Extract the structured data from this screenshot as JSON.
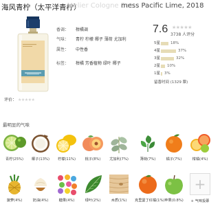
{
  "header": {
    "title_cn": "海风青柠（太平洋青柠）",
    "title_ghost": "Atelier Cologne Bot",
    "title_en": "mess Pacific Lime, 2018"
  },
  "info": {
    "family_label": "香调：",
    "family_value": "柑橘调",
    "smell_label": "气味：",
    "smell_value": "青柠 柠檬 椰子 薄荷 尤加利",
    "gender_label": "属性：",
    "gender_value": "中性香",
    "tags_label": "标签：",
    "tags_value": "柑橘 芳香植物 绿叶 椰子"
  },
  "score": {
    "value": "7.6",
    "stars": "★★★★★",
    "votes": "3738 人评分"
  },
  "distribution": [
    {
      "label": "5星",
      "pct": "18%",
      "frac": 0.18
    },
    {
      "label": "4星",
      "pct": "37%",
      "frac": 0.37
    },
    {
      "label": "3星",
      "pct": "32%",
      "frac": 0.32
    },
    {
      "label": "2星",
      "pct": "10%",
      "frac": 0.1
    },
    {
      "label": "1星",
      "pct": "3%",
      "frac": 0.03
    }
  ],
  "distribution_link": "留香时间 (1329 票)",
  "my_rating": {
    "label": "评价：",
    "stars": "★★★★★"
  },
  "notes_section": {
    "title": "最明显的气味",
    "rows": [
      [
        {
          "icon": "lime-icon",
          "label": "青柠(25%)"
        },
        {
          "icon": "coconut-icon",
          "label": "椰子(13%)"
        },
        {
          "icon": "lemon-icon",
          "label": "柠檬(11%)"
        },
        {
          "icon": "peach-icon",
          "label": "桃子(8%)"
        },
        {
          "icon": "eucalyptus-icon",
          "label": "尤加利(7%)"
        },
        {
          "icon": "mint-icon",
          "label": "薄荷(7%)"
        },
        {
          "icon": "orange-icon",
          "label": "橘子(7%)"
        },
        {
          "icon": "citrus-icon",
          "label": "柑橘(4%)"
        }
      ],
      [
        {
          "icon": "pineapple-icon",
          "label": "菠萝(4%)"
        },
        {
          "icon": "cream-icon",
          "label": "奶油(4%)"
        },
        {
          "icon": "candy-icon",
          "label": "糖果(4%)"
        },
        {
          "icon": "greenleaf-icon",
          "label": "绿叶(2%)"
        },
        {
          "icon": "wood-icon",
          "label": "木质(1%)"
        },
        {
          "icon": "clementine-icon",
          "label": "克里曼丁红橘(1%)"
        },
        {
          "icon": "apple-icon",
          "label": "苹果(0.8%)"
        },
        {
          "icon": "add-note-icon",
          "label": "+ 气味投票"
        }
      ]
    ]
  },
  "colors": {
    "bar": "#e6dcb6",
    "bottle_cap": "#1d3e6b",
    "bottle_label": "#f1d9a8",
    "bottle_band": "#5b9cb0"
  }
}
